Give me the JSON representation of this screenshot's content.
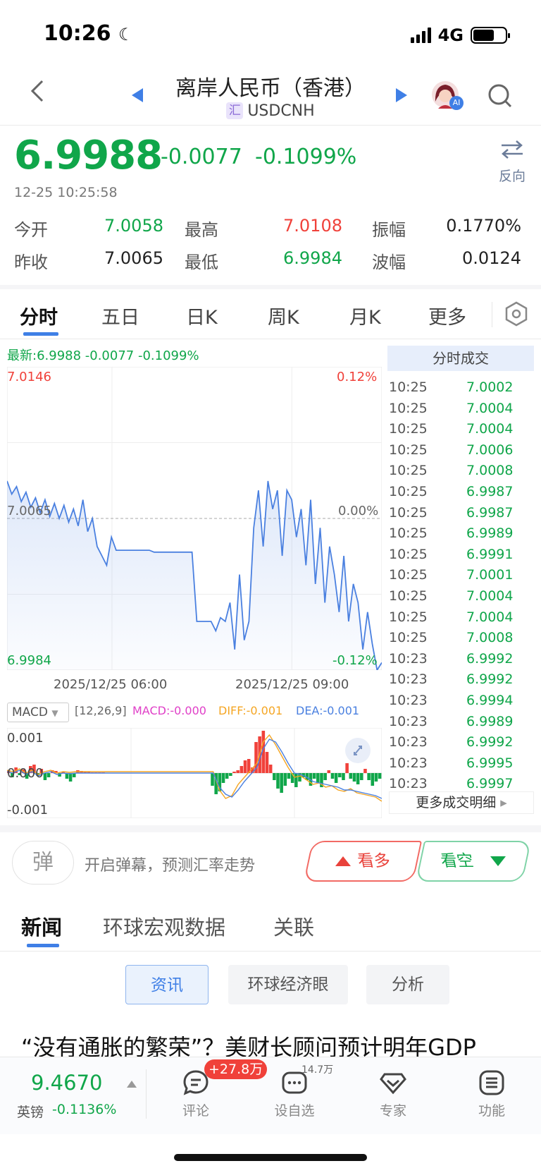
{
  "status": {
    "time": "10:26",
    "network": "4G",
    "battery_level": 0.65
  },
  "header": {
    "title": "离岸人民币（香港）",
    "tag": "汇",
    "symbol": "USDCNH",
    "avatar_badge": "AI"
  },
  "quote": {
    "price": "6.9988",
    "change": "-0.0077",
    "change_pct": "-0.1099%",
    "timestamp": "12-25 10:25:58",
    "reverse_label": "反向",
    "stats": [
      {
        "label": "今开",
        "value": "7.0058",
        "color": "#10a64a"
      },
      {
        "label": "最高",
        "value": "7.0108",
        "color": "#f0413a"
      },
      {
        "label": "振幅",
        "value": "0.1770%",
        "color": "#222"
      },
      {
        "label": "昨收",
        "value": "7.0065",
        "color": "#222"
      },
      {
        "label": "最低",
        "value": "6.9984",
        "color": "#10a64a"
      },
      {
        "label": "波幅",
        "value": "0.0124",
        "color": "#222"
      }
    ]
  },
  "chart_tabs": [
    "分时",
    "五日",
    "日K",
    "周K",
    "月K",
    "更多"
  ],
  "intraday": {
    "latest_label": "最新:6.9988  -0.0077  -0.1099%",
    "y_max": "7.0146",
    "y_mid": "7.0065",
    "y_min": "6.9984",
    "pct_max": "0.12%",
    "pct_mid": "0.00%",
    "pct_min": "-0.12%",
    "x_labels": [
      "2025/12/25 06:00",
      "2025/12/25 09:00"
    ]
  },
  "chart_data": {
    "type": "line",
    "ylim": [
      6.9984,
      7.0146
    ],
    "baseline": 7.0065,
    "x_labels": [
      "2025/12/25 06:00",
      "2025/12/25 09:00"
    ],
    "series": [
      {
        "values": [
          7.0085,
          7.0078,
          7.0082,
          7.0074,
          7.0079,
          7.0071,
          7.0076,
          7.0068,
          7.0075,
          7.0066,
          7.0073,
          7.0065,
          7.0072,
          7.0063,
          7.007,
          7.0061,
          7.0075,
          7.0058,
          7.0065,
          7.005,
          7.0045,
          7.004,
          7.0055,
          7.0048,
          7.0048,
          7.0048,
          7.0048,
          7.0048,
          7.0048,
          7.0048,
          7.0048,
          7.0047,
          7.0047,
          7.0047,
          7.0047,
          7.0047,
          7.0047,
          7.0047,
          7.0047,
          7.0047,
          7.001,
          7.001,
          7.001,
          7.001,
          7.0005,
          7.0012,
          7.001,
          7.002,
          6.9995,
          7.0035,
          7.0,
          7.001,
          7.006,
          7.008,
          7.005,
          7.0085,
          7.007,
          7.008,
          7.0045,
          7.008,
          7.0075,
          7.0055,
          7.007,
          7.004,
          7.0075,
          7.003,
          7.006,
          7.002,
          7.005,
          7.0035,
          7.0015,
          7.0045,
          7.001,
          7.003,
          7.002,
          6.9995,
          7.0015,
          6.9998,
          6.9984,
          6.9988
        ]
      }
    ]
  },
  "trades": {
    "header": "分时成交",
    "rows": [
      [
        "10:25",
        "7.0002"
      ],
      [
        "10:25",
        "7.0004"
      ],
      [
        "10:25",
        "7.0004"
      ],
      [
        "10:25",
        "7.0006"
      ],
      [
        "10:25",
        "7.0008"
      ],
      [
        "10:25",
        "6.9987"
      ],
      [
        "10:25",
        "6.9987"
      ],
      [
        "10:25",
        "6.9989"
      ],
      [
        "10:25",
        "6.9991"
      ],
      [
        "10:25",
        "7.0001"
      ],
      [
        "10:25",
        "7.0004"
      ],
      [
        "10:25",
        "7.0004"
      ],
      [
        "10:25",
        "7.0008"
      ],
      [
        "10:23",
        "6.9992"
      ],
      [
        "10:23",
        "6.9992"
      ],
      [
        "10:23",
        "6.9994"
      ],
      [
        "10:23",
        "6.9989"
      ],
      [
        "10:23",
        "6.9992"
      ],
      [
        "10:23",
        "6.9995"
      ],
      [
        "10:23",
        "6.9997"
      ]
    ],
    "more": "更多成交明细"
  },
  "macd": {
    "selector": "MACD",
    "params": "[12,26,9]",
    "macd": "MACD:-0.000",
    "diff": "DIFF:-0.001",
    "dea": "DEA:-0.001",
    "y_top": "0.001",
    "y_mid": "0.000",
    "y_bot": "-0.001",
    "colors": {
      "macd": "#e040c8",
      "diff": "#f5a623",
      "dea": "#4a80e0"
    }
  },
  "danmu": {
    "icon_char": "弹",
    "text": "开启弹幕，预测汇率走势",
    "bull": "看多",
    "bear": "看空"
  },
  "news_tabs": [
    "新闻",
    "环球宏观数据",
    "关联"
  ],
  "news_chips": [
    "资讯",
    "环球经济眼",
    "分析"
  ],
  "headline": "“没有通胀的繁荣”？美财长顾问预计明年GDP",
  "bottom": {
    "price": "9.4670",
    "name": "英镑",
    "change": "-0.1136%",
    "nav": [
      {
        "label": "评论",
        "badge": "+27.8万"
      },
      {
        "label": "设自选",
        "badge": "14.7万"
      },
      {
        "label": "专家"
      },
      {
        "label": "功能"
      }
    ]
  }
}
